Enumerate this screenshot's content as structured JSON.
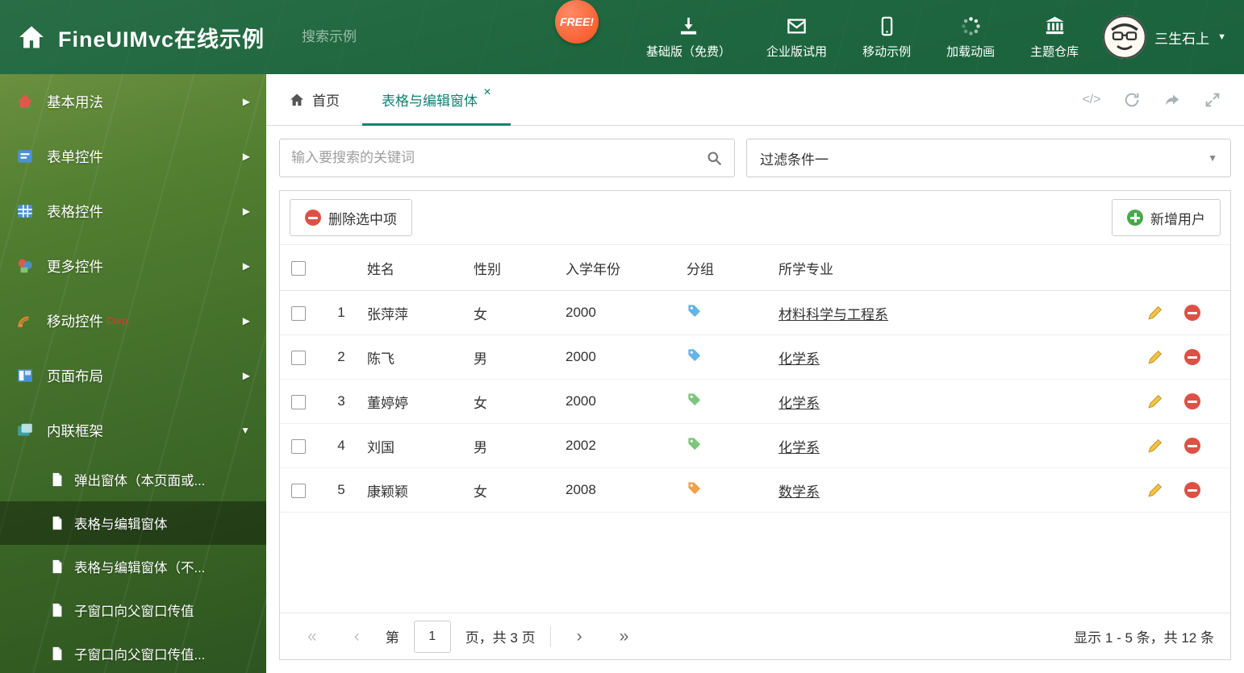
{
  "header": {
    "title": "FineUIMvc在线示例",
    "search_placeholder": "搜索示例",
    "free_badge": "FREE!",
    "nav": [
      {
        "label": "基础版（免费）"
      },
      {
        "label": "企业版试用"
      },
      {
        "label": "移动示例"
      },
      {
        "label": "加载动画"
      },
      {
        "label": "主题仓库"
      }
    ],
    "user_name": "三生石上"
  },
  "sidebar": {
    "items": [
      {
        "label": "基本用法"
      },
      {
        "label": "表单控件"
      },
      {
        "label": "表格控件"
      },
      {
        "label": "更多控件"
      },
      {
        "label": "移动控件",
        "badge": "Corp."
      },
      {
        "label": "页面布局"
      },
      {
        "label": "内联框架"
      }
    ],
    "subitems": [
      {
        "label": "弹出窗体（本页面或..."
      },
      {
        "label": "表格与编辑窗体"
      },
      {
        "label": "表格与编辑窗体（不..."
      },
      {
        "label": "子窗口向父窗口传值"
      },
      {
        "label": "子窗口向父窗口传值..."
      }
    ]
  },
  "tabs": {
    "home_label": "首页",
    "active_label": "表格与编辑窗体"
  },
  "filter": {
    "search_placeholder": "输入要搜索的关键词",
    "dropdown_value": "过滤条件一"
  },
  "toolbar": {
    "delete_label": "删除选中项",
    "add_label": "新增用户"
  },
  "table": {
    "columns": {
      "name": "姓名",
      "gender": "性别",
      "year": "入学年份",
      "group": "分组",
      "major": "所学专业"
    },
    "rows": [
      {
        "num": "1",
        "name": "张萍萍",
        "gender": "女",
        "year": "2000",
        "tag_color": "#62b5e5",
        "major": "材料科学与工程系"
      },
      {
        "num": "2",
        "name": "陈飞",
        "gender": "男",
        "year": "2000",
        "tag_color": "#62b5e5",
        "major": "化学系"
      },
      {
        "num": "3",
        "name": "董婷婷",
        "gender": "女",
        "year": "2000",
        "tag_color": "#7cc57c",
        "major": "化学系"
      },
      {
        "num": "4",
        "name": "刘国",
        "gender": "男",
        "year": "2002",
        "tag_color": "#7cc57c",
        "major": "化学系"
      },
      {
        "num": "5",
        "name": "康颖颖",
        "gender": "女",
        "year": "2008",
        "tag_color": "#f0a04b",
        "major": "数学系"
      }
    ]
  },
  "pagination": {
    "first": "«",
    "prev": "‹",
    "label_before": "第",
    "page_value": "1",
    "label_after": "页，共 3 页",
    "next": "›",
    "last": "»",
    "summary": "显示 1 - 5 条，共 12 条"
  },
  "icons": {
    "menu_arrow": "▶",
    "menu_expanded": "▼",
    "dropdown_caret": "▼",
    "user_caret": "▼",
    "tab_close": "✕",
    "code": "</>"
  },
  "colors": {
    "accent_teal": "#0e8374",
    "delete_red": "#dd5145",
    "add_green": "#49a84c",
    "pencil_yellow": "#f5c242"
  }
}
